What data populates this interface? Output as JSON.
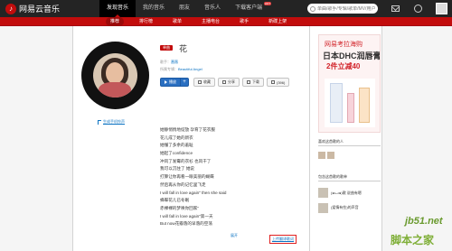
{
  "topnav": {
    "logo": "网易云音乐",
    "items": [
      {
        "label": "发现音乐"
      },
      {
        "label": "我的音乐"
      },
      {
        "label": "朋友"
      },
      {
        "label": "音乐人"
      },
      {
        "label": "下载客户端",
        "badge": "HOT"
      }
    ],
    "search_placeholder": "单曲/歌手/专辑/歌单/MV/用户"
  },
  "subnav": {
    "items": [
      "推荐",
      "排行榜",
      "歌单",
      "主播电台",
      "歌手",
      "新碟上架"
    ]
  },
  "song": {
    "tag": "单曲",
    "title": "花",
    "singer_label": "歌手：",
    "singer": "蔷薇",
    "album_label": "所属专辑：",
    "album": "Beautiful Angel",
    "ringtone": "生成手机铃声",
    "buttons": {
      "play": "播放",
      "add": "+",
      "collect": "收藏",
      "share": "分享",
      "download": "下载",
      "comment": "(396)"
    }
  },
  "lyrics": [
    "她静悄悄地绽放 孕育了花衣服",
    "花儿成了她的新衣",
    "她懂了多余的羞耻",
    "她起了confidence",
    "冲风了发霉的衣衫 也风干了",
    "我可以沉住了 她说",
    "打算让你再看一眼美丽的蝴蝶",
    "然后再从你的记忆里飞走",
    "I will fall in love again\" then she said",
    "蜂蝶花儿已冬眠",
    "赤裸裸的梦唤你回家\"",
    "I will fall in love again\"第一天",
    "But now花瓣落的早落的空荡"
  ],
  "expand": "展开",
  "upload": "上传翻译歌词",
  "sidebar": {
    "ad_brand": "网易考拉海购",
    "ad_headline": "日本DHC润唇膏",
    "ad_sub": "2件立减40",
    "liked_title": "喜欢这首歌的人",
    "playlist_title": "包含这首歌的歌单",
    "playlists": [
      {
        "name": "(๑•ᴗ•๑)歌 说曲有嗯"
      },
      {
        "name": "(爱情有些)的声音"
      }
    ]
  },
  "watermark": {
    "site": "jb51.net",
    "cn": "脚本之家"
  },
  "colors": {
    "brand_red": "#c20c0c",
    "link_blue": "#0c73c2",
    "topbar_bg": "#242424",
    "highlight_box": "#e02020"
  }
}
